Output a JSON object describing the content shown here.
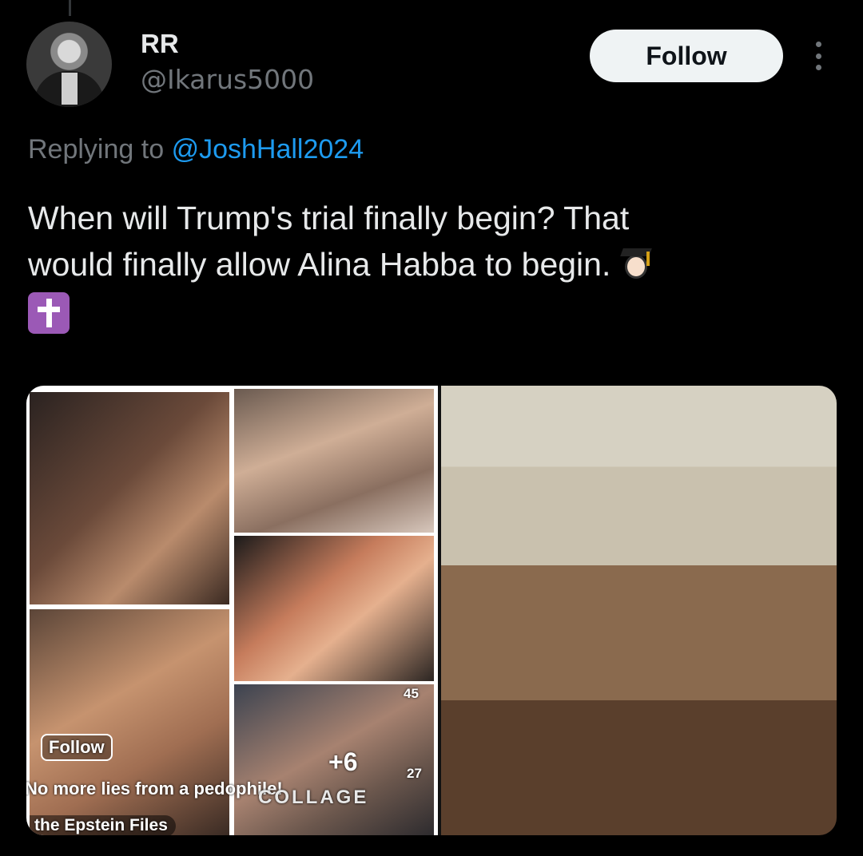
{
  "author": {
    "display_name": "RR",
    "handle": "@Ikarus5000"
  },
  "follow_label": "Follow",
  "reply": {
    "prefix": "Replying to",
    "mention": "@JoshHall2024"
  },
  "tweet": {
    "line1": "When will Trump's trial finally begin? That",
    "line2": "would finally allow Alina Habba to begin.",
    "emoji_1": "student-emoji",
    "emoji_2": "latin-cross-emoji"
  },
  "media": {
    "overlay_follow": "Follow",
    "overlay_plus": "+6",
    "overlay_count_1": "45",
    "overlay_count_2": "27",
    "overlay_caption": "No more lies from a pedophile!",
    "overlay_watermark": "COLLAGE",
    "overlay_tag": "the Epstein Files"
  },
  "colors": {
    "background": "#000000",
    "text": "#e7e9ea",
    "muted": "#71767b",
    "link": "#1d9bf0",
    "follow_bg": "#eff3f4"
  }
}
